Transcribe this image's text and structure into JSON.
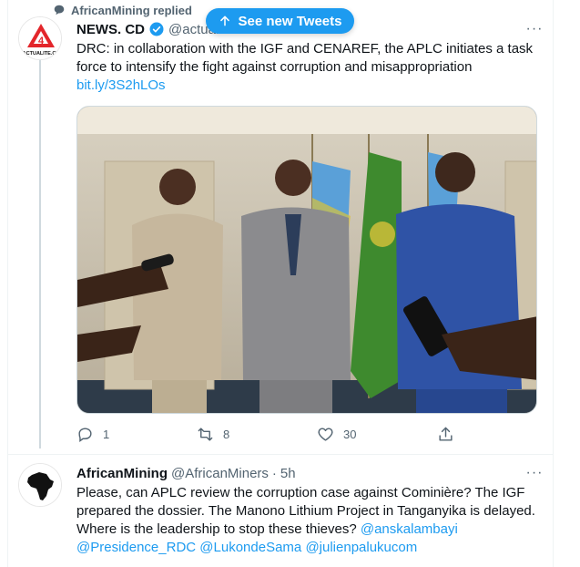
{
  "reply_context": {
    "label": "AfricanMining replied"
  },
  "new_tweets_banner": {
    "label": "See new Tweets"
  },
  "tweet1": {
    "name": "NEWS. CD",
    "handle": "@actualitecd",
    "text": "DRC: in collaboration with the IGF and CENAREF, the APLC initiates a task force to intensify the fight against corruption and misappropriation",
    "link": "bit.ly/3S2hLOs",
    "logo_text": "ACTUALITE.CD",
    "counts": {
      "replies": "1",
      "retweets": "8",
      "likes": "30"
    }
  },
  "tweet2": {
    "name": "AfricanMining",
    "handle": "@AfricanMiners",
    "separator": "·",
    "time": "5h",
    "text": "Please, can APLC review the corruption case against Cominière? The IGF prepared the dossier. The Manono Lithium Project in Tanganyika is delayed. Where is the leadership to stop these thieves?",
    "mentions": [
      "@anskalambayi",
      "@Presidence_RDC",
      "@LukondeSama",
      "@julienpalukucom"
    ]
  },
  "icons": {
    "reply": "reply-icon",
    "retweet": "retweet-icon",
    "like": "heart-icon",
    "share": "share-icon",
    "more": "more-icon",
    "verified": "verified-badge-icon",
    "up": "arrow-up-icon"
  },
  "colors": {
    "accent": "#1d9bf0",
    "text": "#0f1419",
    "muted": "#536471",
    "logo_red": "#e3262b"
  }
}
